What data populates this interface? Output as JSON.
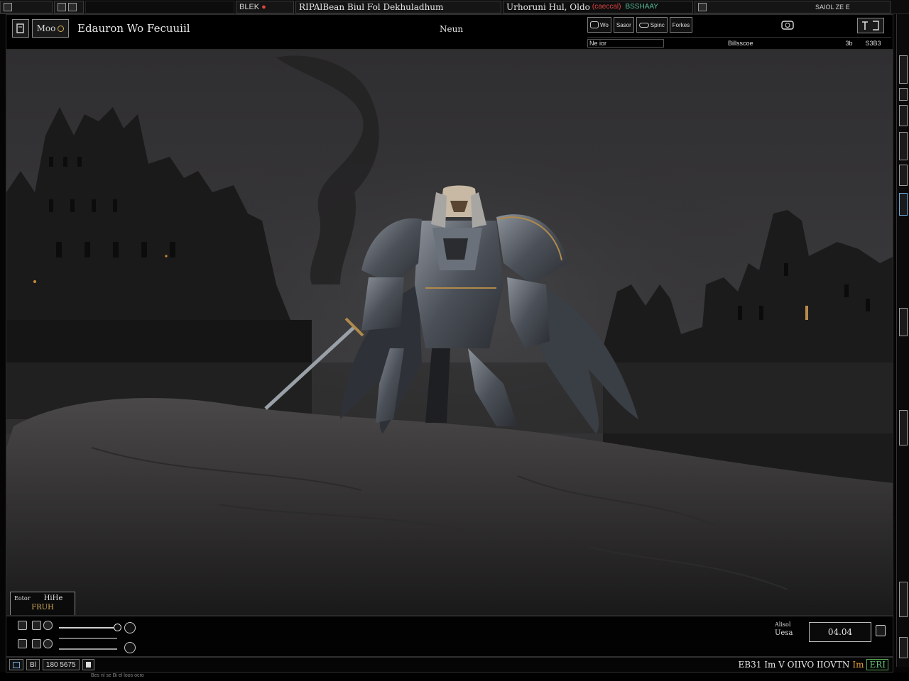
{
  "os_strip": {
    "left_label": "",
    "path_label": "BLEK",
    "tab_title": "RIPAlBean Biul Fol Dekhuladhum",
    "window_title": "Urhoruni Hul, Oldo",
    "red_tag": "(caeccal)",
    "green_tag": "BSSHAAY",
    "right_label": "SAIOL ZE E"
  },
  "header": {
    "logo_label": "Moo",
    "app_title": "Edauron Wo Fecuuiil",
    "center_label": "Neun",
    "tools": [
      "Wo",
      "Sasor",
      "Spinc",
      "Forkes"
    ],
    "sub_field": "Ne ior",
    "sub_center": "Billsscoe",
    "sub_right_a": "3b",
    "sub_right_b": "S3B3"
  },
  "viewport": {
    "corner_badge_top": "Eotor",
    "corner_badge_main": "HiHe",
    "corner_badge_sub": "FRUH"
  },
  "controls": {
    "readout_label_top": "Alisol",
    "readout_label_bottom": "Uesa",
    "readout_value": "04.04"
  },
  "status_bar": {
    "item_a": "Bl",
    "item_b": "180 5675",
    "right_text": "EB31 Im V OIIVO IIOVTN",
    "right_orange": "Im",
    "right_green": "ERI"
  },
  "footer": {
    "text": "Bes nl se Bi el loos ocro"
  },
  "colors": {
    "accent_gold": "#d8b05a",
    "accent_orange": "#e49a3a",
    "accent_green": "#68c07a",
    "accent_red": "#dd4444"
  }
}
